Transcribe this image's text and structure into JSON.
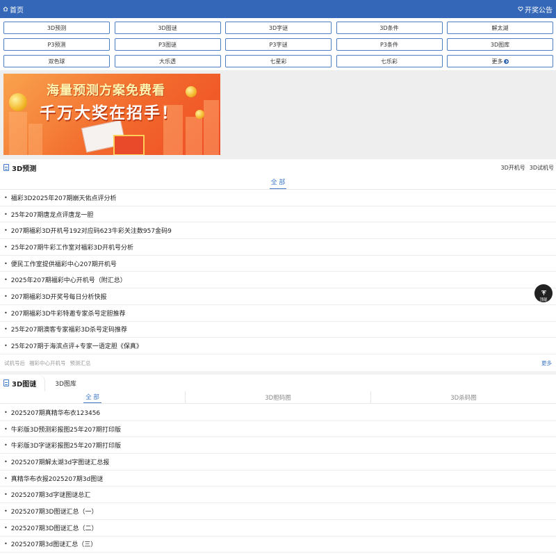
{
  "topbar": {
    "home_label": "首页",
    "notice_label": "开奖公告"
  },
  "nav": [
    "3D预测",
    "3D图谜",
    "3D字谜",
    "3D条件",
    "解太湖",
    "P3预测",
    "P3图谜",
    "P3字谜",
    "P3条件",
    "3D图库",
    "双色球",
    "大乐透",
    "七星彩",
    "七乐彩",
    "更多"
  ],
  "banner": {
    "line1": "海量预测方案免费看",
    "line2": "千万大奖在招手！"
  },
  "section1": {
    "title": "3D预测",
    "right_links": [
      "3D开机号",
      "3D试机号"
    ],
    "tab": "全 部",
    "items": [
      "福彩3D2025年207期崩天佑点评分析",
      "25年207期唐龙点评唐龙一胆",
      "207期福彩3D开机号192对应码623牛彩关注数957金码9",
      "25年207期牛彩工作室对福彩3D开机号分析",
      "便民工作室提供福彩中心207期开机号",
      "2025年207期福彩中心开机号（附汇总）",
      "207期福彩3D开奖号每日分析快报",
      "207期福彩3D牛彩特邀专家杀号定胆推荐",
      "25年207期澳客专家福彩3D杀号定码推荐",
      "25年207期于海滨点评+专家一语定胆《保真》"
    ],
    "footer_links": [
      "试机号后",
      "福彩中心开机号",
      "预测汇总"
    ],
    "more": "更多"
  },
  "section2": {
    "tab_a": "3D图谜",
    "tab_b": "3D图库",
    "subtabs": [
      "全 部",
      "3D胆码图",
      "3D杀码图"
    ],
    "items": [
      "2025207期真精华布衣123456",
      "牛彩版3D预测彩报图25年207期打印版",
      "牛彩版3D字谜彩报图25年207期打印版",
      "2025207期解太湖3d字图谜汇总报",
      "真精华布衣报2025207期3d图谜",
      "2025207期3d字谜图谜总汇",
      "2025207期3D图谜汇总（一）",
      "2025207期3D图谜汇总（二）",
      "2025207期3d图谜汇总（三）"
    ]
  },
  "totop": {
    "label": "顶部"
  }
}
